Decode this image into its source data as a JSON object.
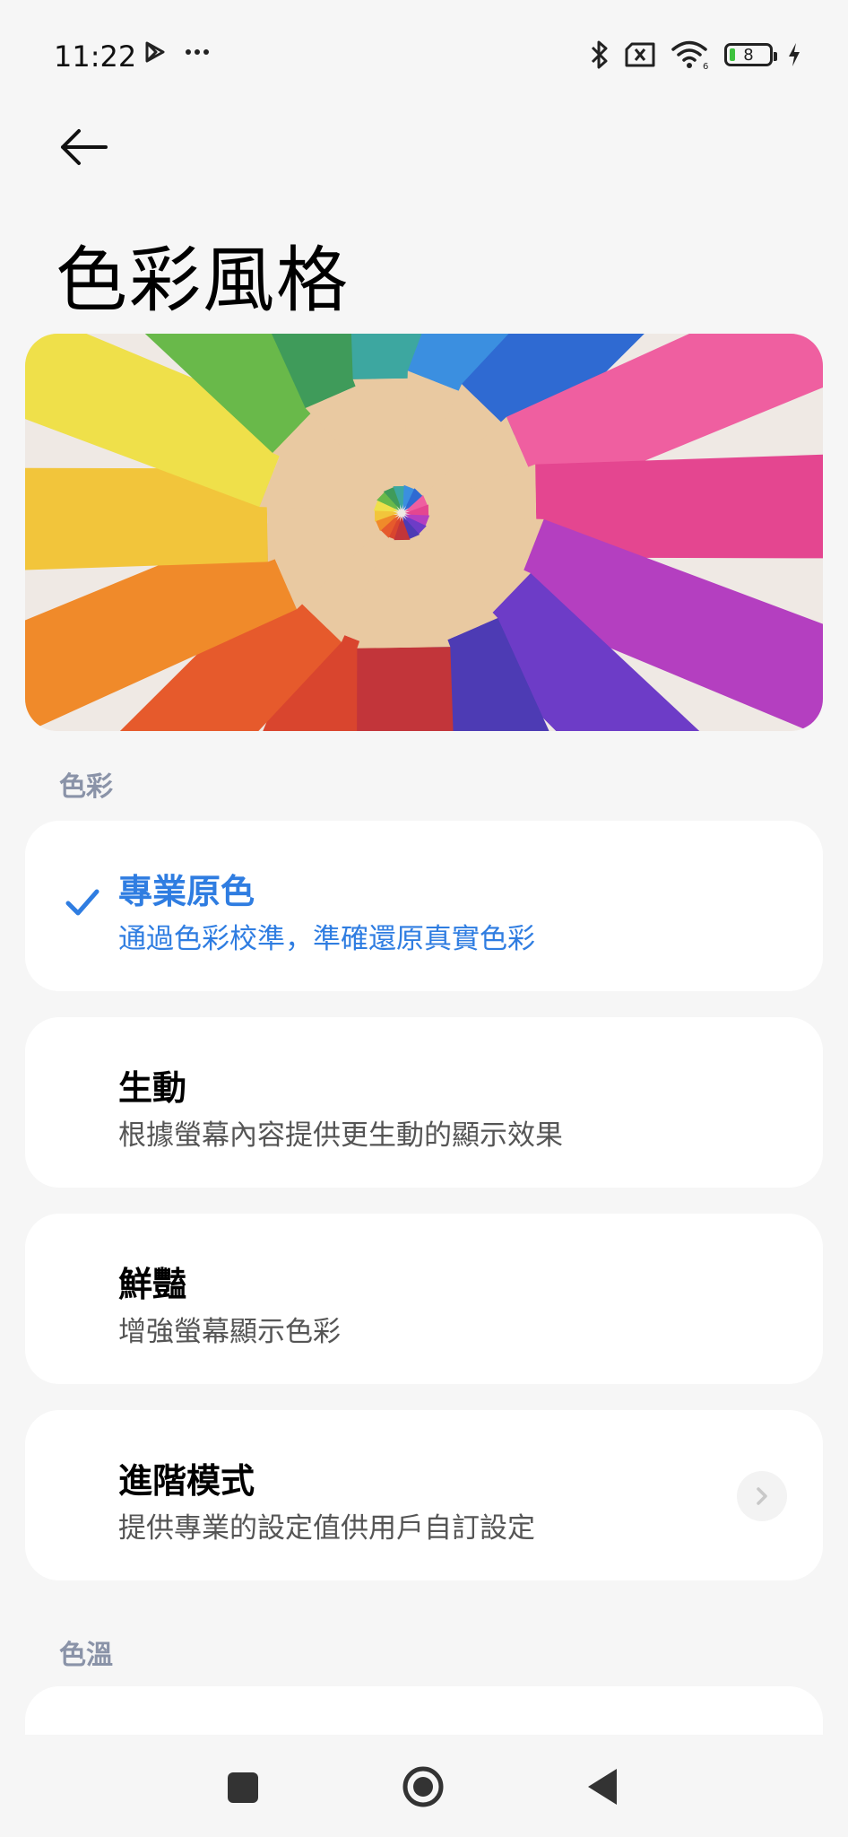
{
  "status_bar": {
    "time": "11:22",
    "left_icons": [
      "play-store-icon",
      "more-dots-icon"
    ],
    "right_icons": [
      "bluetooth-icon",
      "sim-off-icon",
      "wifi-icon",
      "battery-icon",
      "charging-icon"
    ],
    "battery_level": "8"
  },
  "header": {
    "back_icon": "arrow-left-icon",
    "title": "色彩風格"
  },
  "hero": {
    "image": "colored-pencils-radial-photo",
    "pencil_colors": [
      "#d9452e",
      "#e65a2c",
      "#f08a2a",
      "#f2c53b",
      "#efe04a",
      "#69b94a",
      "#3f9b5a",
      "#3da7a0",
      "#3b8fe0",
      "#2f6ad2",
      "#ef5fa0",
      "#e44690",
      "#b43fc0",
      "#6d3cc7",
      "#4d3bb4",
      "#c2353a"
    ]
  },
  "sections": {
    "color_label": "色彩",
    "temperature_label": "色溫"
  },
  "options": [
    {
      "title": "專業原色",
      "subtitle": "通過色彩校準，準確還原真實色彩",
      "selected": true
    },
    {
      "title": "生動",
      "subtitle": "根據螢幕內容提供更生動的顯示效果",
      "selected": false
    },
    {
      "title": "鮮豔",
      "subtitle": "增強螢幕顯示色彩",
      "selected": false
    },
    {
      "title": "進階模式",
      "subtitle": "提供專業的設定值供用戶自訂設定",
      "selected": false,
      "has_chevron": true
    }
  ],
  "colors": {
    "accent": "#2f7de1",
    "background": "#f6f6f6",
    "card": "#ffffff",
    "section_label": "#8a93a8"
  },
  "nav": {
    "icons": [
      "recent-apps-icon",
      "home-icon",
      "back-triangle-icon"
    ]
  }
}
